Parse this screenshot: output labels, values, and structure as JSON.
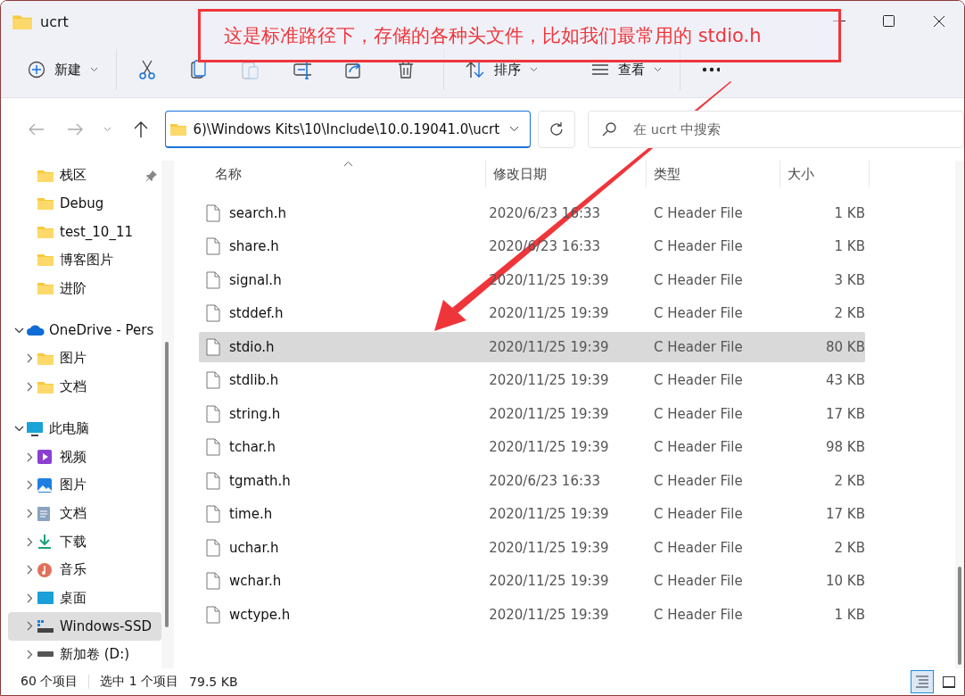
{
  "window": {
    "title": "ucrt"
  },
  "annotation": {
    "text": "这是标准路径下，存储的各种头文件，比如我们最常用的 stdio.h"
  },
  "toolbar": {
    "items": [
      {
        "kind": "new",
        "label": "新建",
        "disabled": false
      },
      {
        "kind": "cut",
        "disabled": false
      },
      {
        "kind": "copy",
        "disabled": false
      },
      {
        "kind": "paste",
        "disabled": true
      },
      {
        "kind": "rename",
        "disabled": false
      },
      {
        "kind": "share",
        "disabled": false
      },
      {
        "kind": "delete",
        "disabled": false
      },
      {
        "kind": "sort",
        "label": "排序",
        "disabled": false
      },
      {
        "kind": "view",
        "label": "查看",
        "disabled": false
      },
      {
        "kind": "more",
        "disabled": false
      }
    ]
  },
  "address": {
    "value": "6)\\Windows Kits\\10\\Include\\10.0.19041.0\\ucrt"
  },
  "search": {
    "placeholder": "在 ucrt 中搜索"
  },
  "sidebar": {
    "quick_access": [
      {
        "label": "栈区",
        "pinned": true,
        "selected": false
      },
      {
        "label": "Debug",
        "pinned": false,
        "selected": false
      },
      {
        "label": "test_10_11",
        "pinned": false,
        "selected": false
      },
      {
        "label": "博客图片",
        "pinned": false,
        "selected": false
      },
      {
        "label": "进阶",
        "pinned": false,
        "selected": false
      }
    ],
    "tree": [
      {
        "label": "OneDrive - Pers",
        "kind": "cloud",
        "expanded": true,
        "selected": false,
        "children": [
          {
            "label": "图片",
            "kind": "folder",
            "expanded": false,
            "selected": false
          },
          {
            "label": "文档",
            "kind": "folder",
            "expanded": false,
            "selected": false
          }
        ]
      },
      {
        "label": "此电脑",
        "kind": "pc",
        "expanded": true,
        "selected": false,
        "children": [
          {
            "label": "视频",
            "kind": "video",
            "expanded": false,
            "selected": false
          },
          {
            "label": "图片",
            "kind": "pictures",
            "expanded": false,
            "selected": false
          },
          {
            "label": "文档",
            "kind": "documents",
            "expanded": false,
            "selected": false
          },
          {
            "label": "下载",
            "kind": "download",
            "expanded": false,
            "selected": false
          },
          {
            "label": "音乐",
            "kind": "music",
            "expanded": false,
            "selected": false
          },
          {
            "label": "桌面",
            "kind": "desktop",
            "expanded": false,
            "selected": false
          },
          {
            "label": "Windows-SSD",
            "kind": "os-drive",
            "expanded": false,
            "selected": true
          },
          {
            "label": "新加卷 (D:)",
            "kind": "drive",
            "expanded": false,
            "selected": false
          }
        ]
      }
    ]
  },
  "table": {
    "columns": [
      {
        "label": "名称",
        "sorted": true
      },
      {
        "label": "修改日期",
        "sorted": false
      },
      {
        "label": "类型",
        "sorted": false
      },
      {
        "label": "大小",
        "sorted": false
      }
    ],
    "rows": [
      {
        "name": "search.h",
        "date": "2020/6/23 16:33",
        "type": "C Header File",
        "size": "1 KB",
        "selected": false
      },
      {
        "name": "share.h",
        "date": "2020/6/23 16:33",
        "type": "C Header File",
        "size": "1 KB",
        "selected": false
      },
      {
        "name": "signal.h",
        "date": "2020/11/25 19:39",
        "type": "C Header File",
        "size": "3 KB",
        "selected": false
      },
      {
        "name": "stddef.h",
        "date": "2020/11/25 19:39",
        "type": "C Header File",
        "size": "2 KB",
        "selected": false
      },
      {
        "name": "stdio.h",
        "date": "2020/11/25 19:39",
        "type": "C Header File",
        "size": "80 KB",
        "selected": true
      },
      {
        "name": "stdlib.h",
        "date": "2020/11/25 19:39",
        "type": "C Header File",
        "size": "43 KB",
        "selected": false
      },
      {
        "name": "string.h",
        "date": "2020/11/25 19:39",
        "type": "C Header File",
        "size": "17 KB",
        "selected": false
      },
      {
        "name": "tchar.h",
        "date": "2020/11/25 19:39",
        "type": "C Header File",
        "size": "98 KB",
        "selected": false
      },
      {
        "name": "tgmath.h",
        "date": "2020/6/23 16:33",
        "type": "C Header File",
        "size": "2 KB",
        "selected": false
      },
      {
        "name": "time.h",
        "date": "2020/11/25 19:39",
        "type": "C Header File",
        "size": "17 KB",
        "selected": false
      },
      {
        "name": "uchar.h",
        "date": "2020/11/25 19:39",
        "type": "C Header File",
        "size": "2 KB",
        "selected": false
      },
      {
        "name": "wchar.h",
        "date": "2020/11/25 19:39",
        "type": "C Header File",
        "size": "10 KB",
        "selected": false
      },
      {
        "name": "wctype.h",
        "date": "2020/11/25 19:39",
        "type": "C Header File",
        "size": "1 KB",
        "selected": false
      }
    ]
  },
  "status_bar": {
    "count": "60 个项目",
    "selection": "选中 1 个项目",
    "size": "79.5 KB",
    "views": [
      {
        "kind": "details",
        "selected": true
      },
      {
        "kind": "tiles",
        "selected": false
      }
    ]
  }
}
